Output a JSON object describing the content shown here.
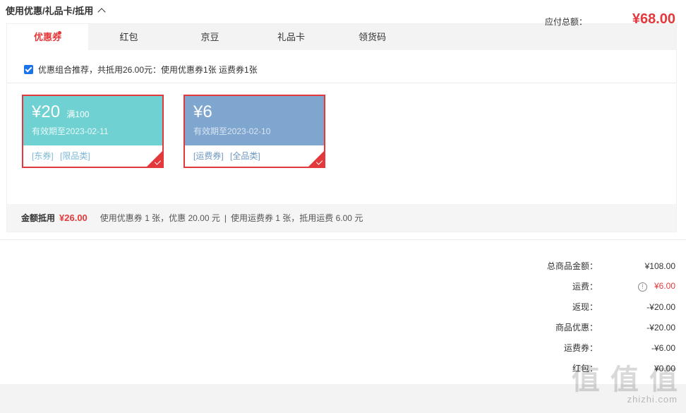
{
  "section": {
    "title": "使用优惠/礼品卡/抵用"
  },
  "tabs": [
    {
      "label": "优惠券"
    },
    {
      "label": "红包"
    },
    {
      "label": "京豆"
    },
    {
      "label": "礼品卡"
    },
    {
      "label": "领货码"
    }
  ],
  "recommend": {
    "text": "优惠组合推荐，共抵用26.00元：使用优惠券1张 运费券1张"
  },
  "coupons": [
    {
      "amount": "¥20",
      "condition": "满100",
      "validity": "有效期至2023-02-11",
      "tags": [
        "[东券]",
        "[限品类]"
      ]
    },
    {
      "amount": "¥6",
      "condition": "",
      "validity": "有效期至2023-02-10",
      "tags": [
        "[运费券]",
        "[全品类]"
      ]
    }
  ],
  "summary": {
    "label": "金额抵用",
    "amount": "¥26.00",
    "detail1": "使用优惠券 1 张，优惠 20.00 元",
    "separator": "|",
    "detail2": "使用运费券 1 张，抵用运费 6.00 元"
  },
  "totals": [
    {
      "label": "总商品金额：",
      "value": "¥108.00"
    },
    {
      "label": "运费：",
      "value": "¥6.00"
    },
    {
      "label": "返现：",
      "value": "-¥20.00"
    },
    {
      "label": "商品优惠：",
      "value": "-¥20.00"
    },
    {
      "label": "运费券：",
      "value": "-¥6.00"
    },
    {
      "label": "红包：",
      "value": "¥0.00"
    }
  ],
  "pay": {
    "label": "应付总额：",
    "value": "¥68.00"
  },
  "watermark": {
    "main": "值 值 值",
    "sub": "zhizhi.com"
  },
  "colors": {
    "accent": "#e4393c",
    "coupon1": "#6fd1d1",
    "coupon2": "#7fa6cf"
  }
}
